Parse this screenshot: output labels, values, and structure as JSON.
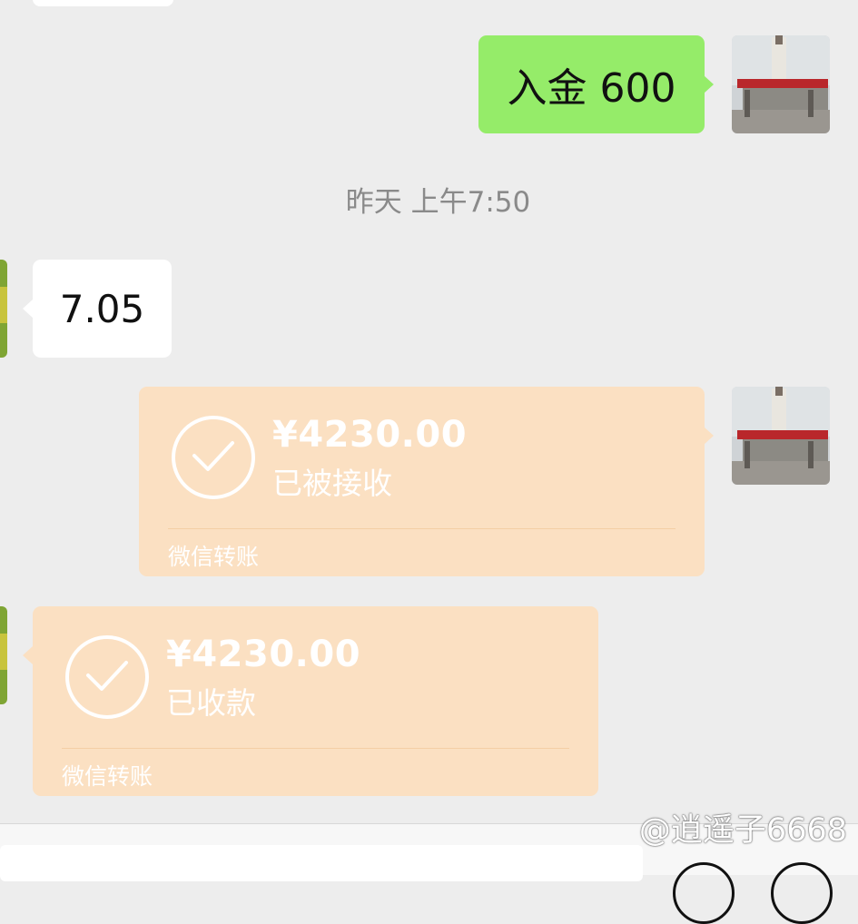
{
  "messages": {
    "sent_text": "入金 600",
    "timestamp": "昨天 上午7:50",
    "received_text": "7.05",
    "transfer_sent": {
      "amount": "¥4230.00",
      "status": "已被接收",
      "label": "微信转账"
    },
    "transfer_received": {
      "amount": "¥4230.00",
      "status": "已收款",
      "label": "微信转账"
    }
  },
  "watermark": "@逍遥子6668",
  "colors": {
    "background": "#ededed",
    "sent_bubble": "#95ec69",
    "transfer_card": "#fbe0c2"
  }
}
